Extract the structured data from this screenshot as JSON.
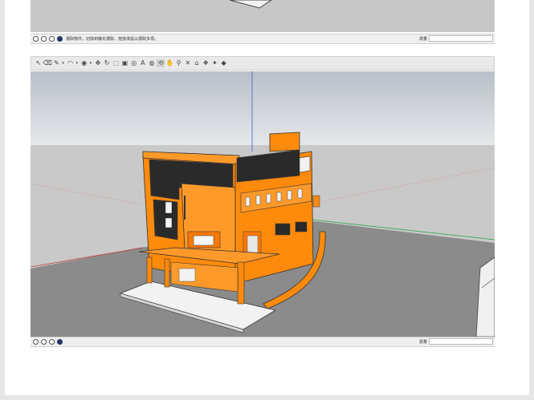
{
  "colors": {
    "sky_top": "#b9c0c8",
    "sky_bottom": "#e4e6e8",
    "ground": "#8b8b8b",
    "far_ground": "#c9c9c9",
    "building_orange": "#ff8a0c",
    "building_dark": "#2a2a2a",
    "slab_white": "#f2f2f2"
  },
  "top_window": {
    "status_text": "選取物件。切換到擴充選取。拖曳滑鼠以選取多項。",
    "measurement_label": "測量"
  },
  "main_window": {
    "toolbar": [
      {
        "icon": "select-arrow-icon"
      },
      {
        "icon": "eraser-icon"
      },
      {
        "icon": "pencil-line-icon",
        "dropdown": true
      },
      {
        "icon": "shapes-icon",
        "dropdown": true
      },
      {
        "icon": "push-pull-icon",
        "dropdown": true
      },
      {
        "icon": "move-icon"
      },
      {
        "icon": "rotate-icon"
      },
      {
        "icon": "scale-icon"
      },
      {
        "icon": "offset-icon"
      },
      {
        "icon": "tape-measure-icon"
      },
      {
        "icon": "text-icon"
      },
      {
        "icon": "paint-bucket-icon"
      },
      {
        "icon": "orbit-icon"
      },
      {
        "icon": "pan-icon"
      },
      {
        "icon": "zoom-icon"
      },
      {
        "icon": "zoom-extents-icon"
      },
      {
        "icon": "warehouse-icon"
      },
      {
        "icon": "extension-warehouse-icon"
      },
      {
        "icon": "layout-icon"
      },
      {
        "icon": "ruby-icon"
      }
    ],
    "status_text": "",
    "measurement_label": "測量"
  }
}
